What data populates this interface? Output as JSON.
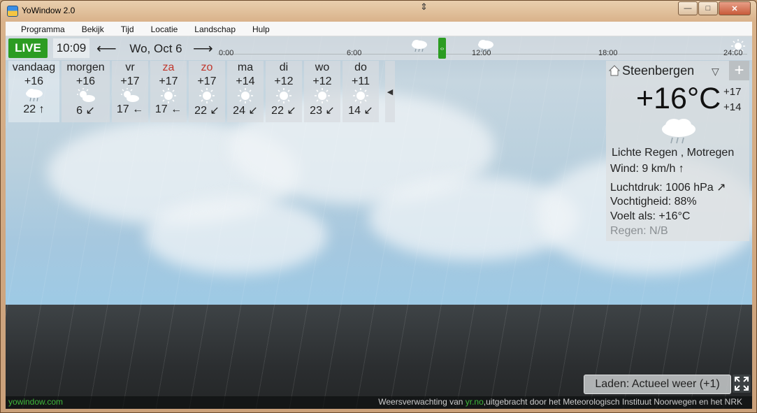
{
  "window": {
    "title": "YoWindow 2.0",
    "buttons": {
      "minimize": "—",
      "maximize": "□",
      "close": "✕"
    }
  },
  "menu": [
    "Programma",
    "Bekijk",
    "Tijd",
    "Locatie",
    "Landschap",
    "Hulp"
  ],
  "timebar": {
    "live_label": "LIVE",
    "time": "10:09",
    "date": "Wo, Oct 6",
    "ticks": [
      "0:00",
      "6:00",
      "12:00",
      "18:00",
      "24:00"
    ]
  },
  "forecast": [
    {
      "day": "vandaag",
      "temp": "+16",
      "icon": "rain-cloud-icon",
      "wind": "22",
      "wind_arrow": "↑",
      "weekend": false
    },
    {
      "day": "morgen",
      "temp": "+16",
      "icon": "sun-cloud-icon",
      "wind": "6",
      "wind_arrow": "↙",
      "weekend": false
    },
    {
      "day": "vr",
      "temp": "+17",
      "icon": "sun-cloud-icon",
      "wind": "17",
      "wind_arrow": "←",
      "weekend": false
    },
    {
      "day": "za",
      "temp": "+17",
      "icon": "sun-icon",
      "wind": "17",
      "wind_arrow": "←",
      "weekend": true
    },
    {
      "day": "zo",
      "temp": "+17",
      "icon": "sun-icon",
      "wind": "22",
      "wind_arrow": "↙",
      "weekend": true
    },
    {
      "day": "ma",
      "temp": "+14",
      "icon": "sun-icon",
      "wind": "24",
      "wind_arrow": "↙",
      "weekend": false
    },
    {
      "day": "di",
      "temp": "+12",
      "icon": "sun-icon",
      "wind": "22",
      "wind_arrow": "↙",
      "weekend": false
    },
    {
      "day": "wo",
      "temp": "+12",
      "icon": "sun-icon",
      "wind": "23",
      "wind_arrow": "↙",
      "weekend": false
    },
    {
      "day": "do",
      "temp": "+11",
      "icon": "sun-icon",
      "wind": "14",
      "wind_arrow": "↙",
      "weekend": false
    }
  ],
  "current": {
    "location": "Steenbergen",
    "temp": "+16°C",
    "high": "+17",
    "low": "+14",
    "condition": "Lichte Regen , Motregen",
    "wind": "Wind:  9 km/h  ↑",
    "pressure": "Luchtdruk:  1006 hPa  ↗",
    "humidity": "Vochtigheid:  88%",
    "feels_like": "Voelt als:  +16°C",
    "rain": "Regen:  N/B"
  },
  "status": {
    "loading": "Laden: Actueel weer (+1)"
  },
  "footer": {
    "brand": "yowindow.com",
    "credit_prefix": "Weersverwachting van ",
    "credit_link": "yr.no",
    "credit_suffix": ",uitgebracht door het Meteorologisch Instituut Noorwegen en het NRK"
  },
  "colors": {
    "live_green": "#2c9c22",
    "weekend_red": "#c0362c",
    "brand_green": "#3fb83a"
  }
}
